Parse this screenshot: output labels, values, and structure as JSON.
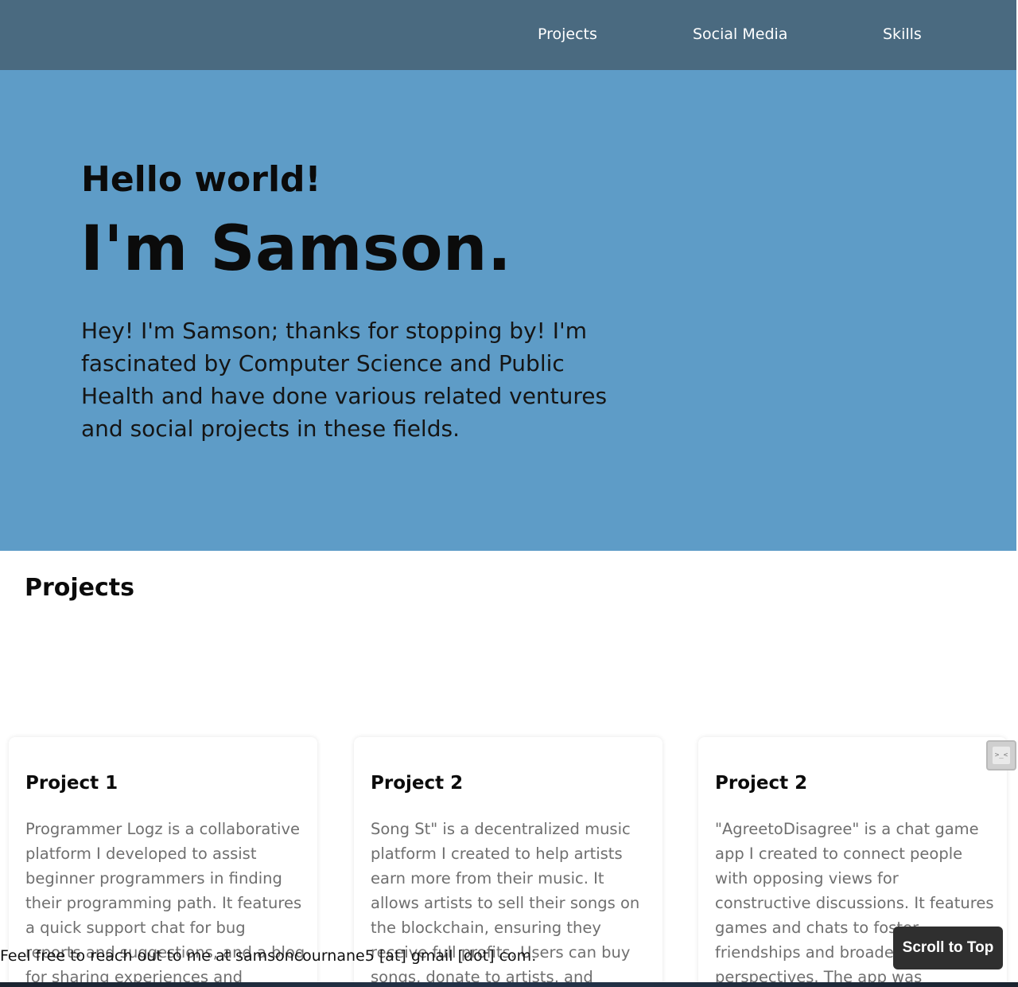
{
  "nav": {
    "items": [
      {
        "label": "Projects"
      },
      {
        "label": "Social Media"
      },
      {
        "label": "Skills"
      }
    ]
  },
  "hero": {
    "greeting": "Hello world!",
    "name": "I'm Samson.",
    "intro": "Hey! I'm Samson; thanks for stopping by! I'm fascinated by Computer Science and Public Health and have done various related ventures and social projects in these fields."
  },
  "projects": {
    "title": "Projects",
    "cards": [
      {
        "title": "Project 1",
        "description": "Programmer Logz is a collaborative platform I developed to assist beginner programmers in finding their programming path. It features a quick support chat for bug reports and suggestions, and a blog for sharing experiences and"
      },
      {
        "title": "Project 2",
        "description": "Song St\" is a decentralized music platform I created to help artists earn more from their music. It allows artists to sell their songs on the blockchain, ensuring they receive full profits. Users can buy songs, donate to artists, and favorite tracks. The app"
      },
      {
        "title": "Project 2",
        "description": "\"AgreetoDisagree\" is a chat game app I created to connect people with opposing views for constructive discussions. It features games and chats to foster friendships and broaden perspectives. The app was developed using Bootstrap, TalkJS,"
      }
    ]
  },
  "footer": {
    "contact": "Feel free to reach out to me at samsoncournane5 [at] gmail [dot] com."
  },
  "scroll_top": {
    "label": "Scroll to Top"
  },
  "widget": {
    "glyph": ">_<"
  },
  "colors": {
    "navbar": "#4a6a80",
    "hero": "#5e9cc7",
    "button": "#2f2f2f"
  }
}
